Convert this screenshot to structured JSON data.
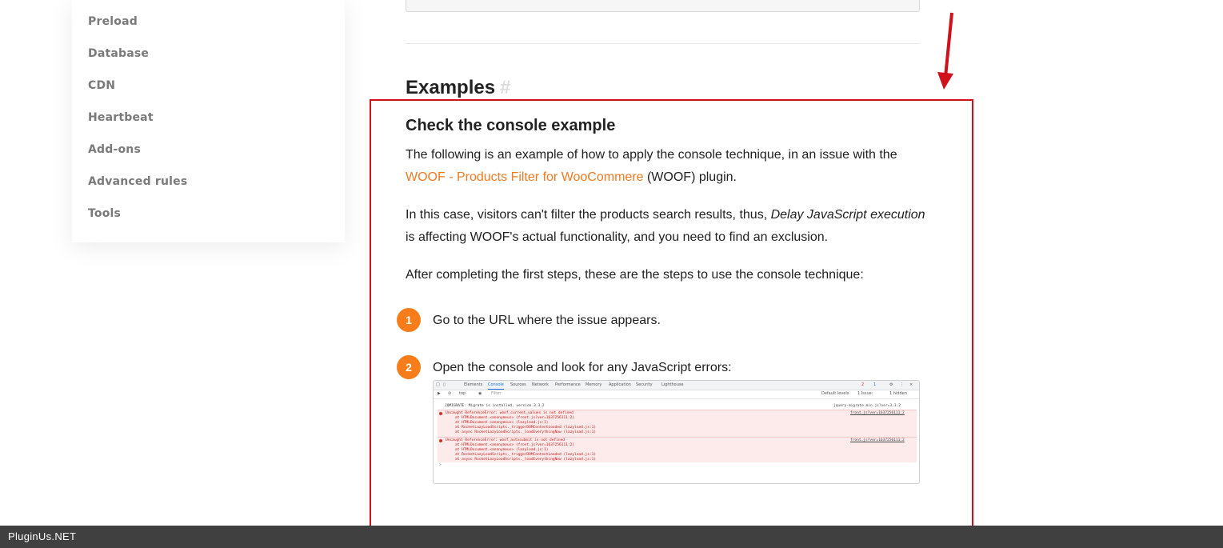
{
  "sidebar": {
    "items": [
      {
        "label": "Preload"
      },
      {
        "label": "Database"
      },
      {
        "label": "CDN"
      },
      {
        "label": "Heartbeat"
      },
      {
        "label": "Add-ons"
      },
      {
        "label": "Advanced rules"
      },
      {
        "label": "Tools"
      }
    ]
  },
  "content": {
    "section_title": "Examples",
    "anchor": "#",
    "subsection_title": "Check the console example",
    "p1_before": "The following is an example of how to apply the console technique, in an issue with the ",
    "p1_link": "WOOF - Products Filter for WooCommere",
    "p1_after": " (WOOF) plugin.",
    "p2_before": "In this case, visitors can't filter the products search results, thus, ",
    "p2_italic": "Delay JavaScript execution",
    "p2_after": " is affecting WOOF's actual functionality, and you need to find an exclusion.",
    "p3": "After completing the first steps, these are the steps to use the console technique:",
    "steps": [
      {
        "number": "1",
        "text": "Go to the URL where the issue appears."
      },
      {
        "number": "2",
        "text": "Open the console and look for any JavaScript errors:"
      }
    ]
  },
  "devtools": {
    "tabs": [
      "Elements",
      "Console",
      "Sources",
      "Network",
      "Performance",
      "Memory",
      "Application",
      "Security",
      "Lighthouse"
    ],
    "active_tab": "Console",
    "context": "top",
    "filter_placeholder": "Filter",
    "levels": "Default levels",
    "issues": "1 Issue:",
    "hidden": "1 hidden",
    "error_count": "2",
    "info_count": "1",
    "info_line": "JQMIGRATE: Migrate is installed, version 3.3.2",
    "info_source": "jquery-migrate.min.js?ver=3.3.2",
    "errors": [
      {
        "lines": [
          "Uncaught ReferenceError: woof_current_values is not defined",
          "at HTMLDocument.<anonymous> (front.js?ver=1637256111:2)",
          "at HTMLDocument.<anonymous> (lazyload.js:1)",
          "at RocketLazyLoadScripts._triggerDOMContentLoaded (lazyload.js:1)",
          "at async RocketLazyLoadScripts._loadEverythingNow (lazyload.js:1)"
        ],
        "source": "front.js?ver=1637256111:2"
      },
      {
        "lines": [
          "Uncaught ReferenceError: woof_autosubmit is not defined",
          "at HTMLDocument.<anonymous> (front.js?ver=1637256111:2)",
          "at HTMLDocument.<anonymous> (lazyload.js:1)",
          "at RocketLazyLoadScripts._triggerDOMContentLoaded (lazyload.js:1)",
          "at async RocketLazyLoadScripts._loadEverythingNow (lazyload.js:1)"
        ],
        "source": "front.js?ver=1637256111:2"
      }
    ],
    "prompt": ">"
  },
  "footer": {
    "label": "PluginUs.NET"
  },
  "colors": {
    "accent": "#f77d1a",
    "link": "#f07a22",
    "highlight_border": "#d0101a",
    "footer_bg": "#404040"
  }
}
